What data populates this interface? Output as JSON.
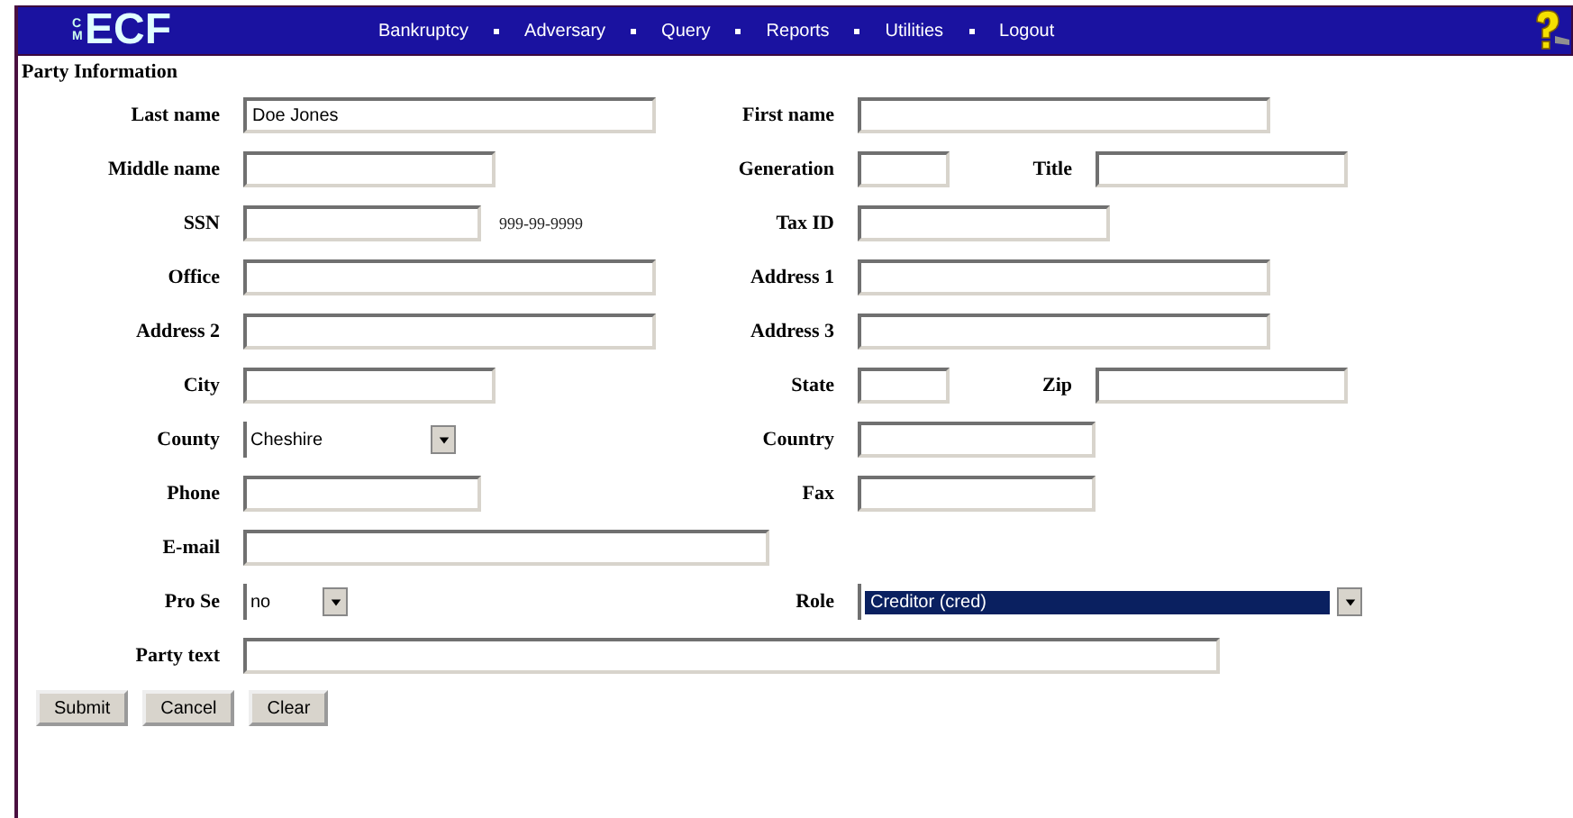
{
  "header": {
    "logo_prefix": "CM",
    "logo": "ECF",
    "menu": [
      "Bankruptcy",
      "Adversary",
      "Query",
      "Reports",
      "Utilities",
      "Logout"
    ]
  },
  "section_title": "Party Information",
  "rows": [
    {
      "kind": "pair",
      "left": {
        "label": "Last name",
        "value": "Doe Jones",
        "kind": "text"
      },
      "right": {
        "label": "First name",
        "kind": "text"
      }
    },
    {
      "kind": "pair",
      "left": {
        "label": "Middle name",
        "kind": "text"
      },
      "right": {
        "label": "Generation",
        "kind": "text"
      },
      "extra": {
        "label": "Title",
        "kind": "text"
      }
    },
    {
      "kind": "pair",
      "left": {
        "label": "SSN",
        "kind": "text",
        "hint": "999-99-9999"
      },
      "right": {
        "label": "Tax ID",
        "kind": "text"
      }
    },
    {
      "kind": "pair",
      "left": {
        "label": "Office",
        "kind": "text"
      },
      "right": {
        "label": "Address 1",
        "kind": "text"
      }
    },
    {
      "kind": "pair",
      "left": {
        "label": "Address 2",
        "kind": "text"
      },
      "right": {
        "label": "Address 3",
        "kind": "text"
      }
    },
    {
      "kind": "pair",
      "left": {
        "label": "City",
        "kind": "text"
      },
      "right": {
        "label": "State",
        "kind": "text"
      },
      "extra": {
        "label": "Zip",
        "kind": "text"
      }
    },
    {
      "kind": "pair",
      "left": {
        "label": "County",
        "value": "Cheshire",
        "kind": "select"
      },
      "right": {
        "label": "Country",
        "kind": "text"
      }
    },
    {
      "kind": "pair",
      "left": {
        "label": "Phone",
        "kind": "text"
      },
      "right": {
        "label": "Fax",
        "kind": "text"
      }
    },
    {
      "kind": "wide",
      "left": {
        "label": "E-mail",
        "kind": "text"
      }
    },
    {
      "kind": "pair",
      "left": {
        "label": "Pro Se",
        "value": "no",
        "kind": "select"
      },
      "right": {
        "label": "Role",
        "value": "Creditor (cred)",
        "kind": "select",
        "selected": true
      }
    },
    {
      "kind": "wide",
      "left": {
        "label": "Party text",
        "kind": "text"
      }
    }
  ],
  "buttons": [
    "Submit",
    "Cancel",
    "Clear"
  ]
}
